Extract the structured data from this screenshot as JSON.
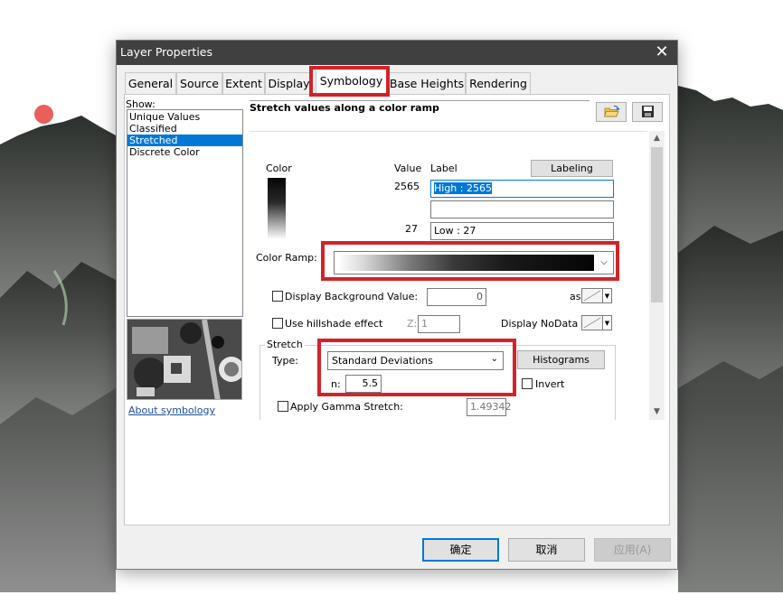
{
  "window": {
    "title": "Layer Properties",
    "close_glyph": "✕"
  },
  "tabs": [
    {
      "label": "General"
    },
    {
      "label": "Source"
    },
    {
      "label": "Extent"
    },
    {
      "label": "Display"
    },
    {
      "label": "Symbology",
      "active": true
    },
    {
      "label": "Base Heights"
    },
    {
      "label": "Rendering"
    }
  ],
  "show": {
    "label": "Show:",
    "items": [
      {
        "label": "Unique Values"
      },
      {
        "label": "Classified"
      },
      {
        "label": "Stretched",
        "selected": true
      },
      {
        "label": "Discrete Color"
      }
    ],
    "about_link": "About symbology"
  },
  "renderer": {
    "heading": "Stretch values along a color ramp",
    "open_icon": "folder-open-icon",
    "save_icon": "floppy-disk-icon",
    "color_col": "Color",
    "value_col": "Value",
    "label_col": "Label",
    "labeling_button": "Labeling",
    "high_value": "2565",
    "high_label": "High : 2565",
    "mid_label": "",
    "low_value": "27",
    "low_label": "Low : 27",
    "color_ramp_label": "Color Ramp:",
    "display_bg_label": "Display Background Value:",
    "bg_value": "0",
    "as_label": "as",
    "hillshade_label": "Use hillshade effect",
    "z_label": "Z:",
    "z_value": "1",
    "nodata_label": "Display NoData as",
    "stretch": {
      "group_title": "Stretch",
      "type_label": "Type:",
      "type_value": "Standard Deviations",
      "histograms_button": "Histograms",
      "n_label": "n:",
      "n_value": "5.5",
      "invert_label": "Invert",
      "gamma_label": "Apply Gamma Stretch:",
      "gamma_value": "1.49342"
    }
  },
  "footer": {
    "ok": "确定",
    "cancel": "取消",
    "apply": "应用(A)"
  },
  "colors": {
    "highlight_box": "#d2232a",
    "selection": "#0078d7",
    "titlebar": "#404040"
  }
}
